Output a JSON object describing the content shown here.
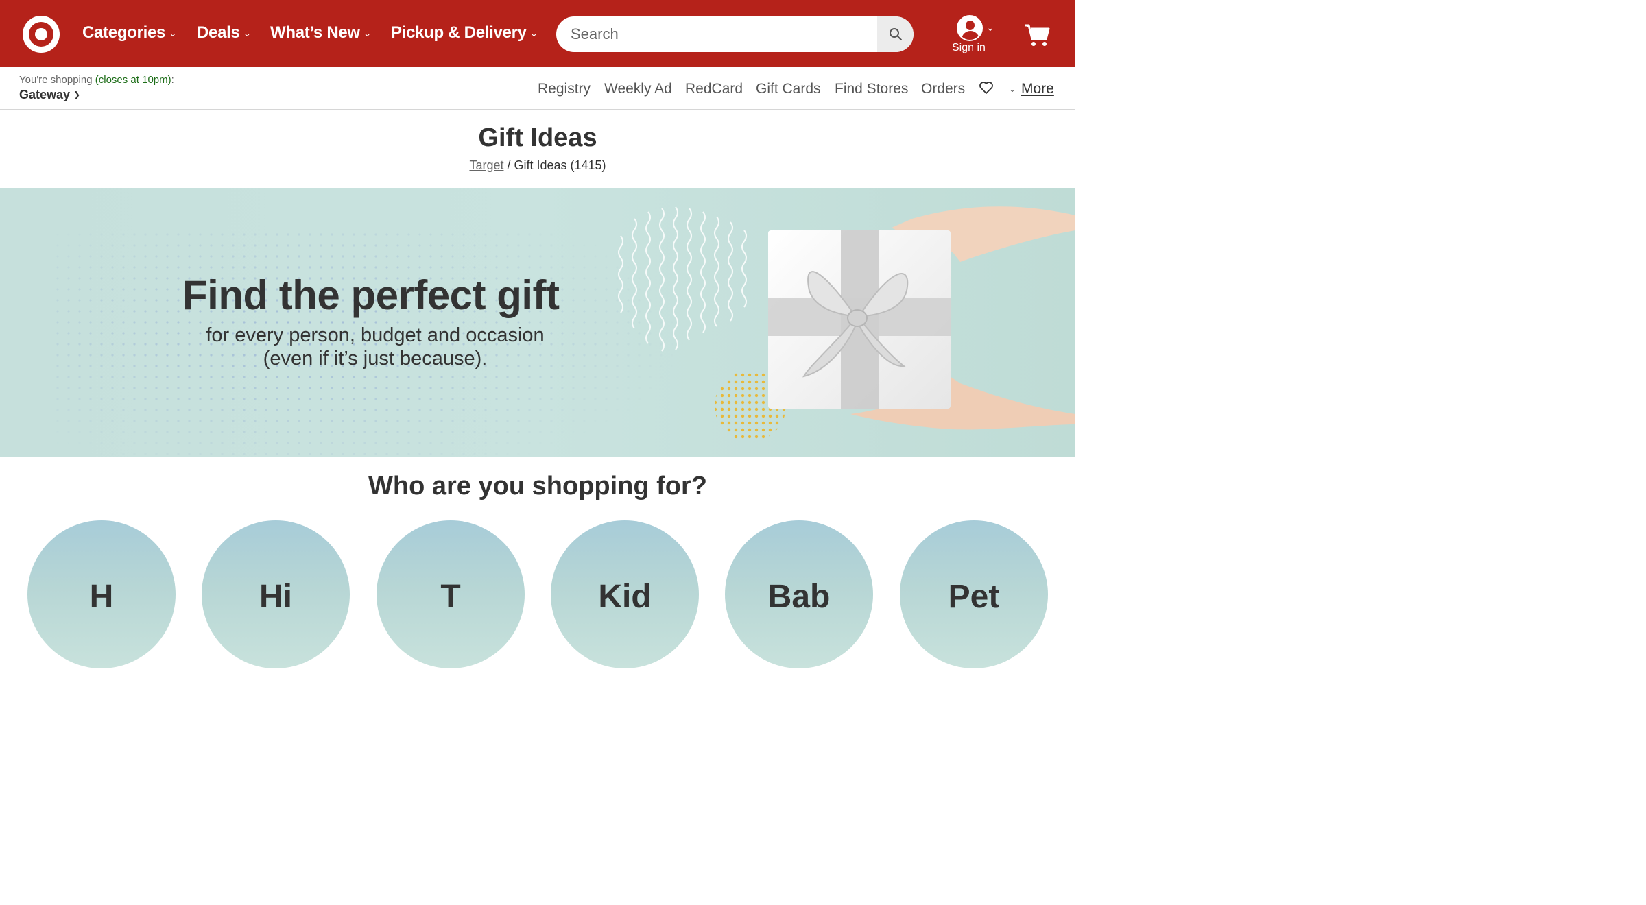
{
  "header": {
    "nav": [
      {
        "label": "Categories"
      },
      {
        "label": "Deals"
      },
      {
        "label": "What’s New"
      },
      {
        "label": "Pickup & Delivery"
      }
    ],
    "search_placeholder": "Search",
    "account_label": "Sign in",
    "brand_color": "#b5221a"
  },
  "subbar": {
    "shopping_prefix": "You're shopping",
    "closes": "(closes at 10pm)",
    "colon": ":",
    "store": "Gateway",
    "links": [
      "Registry",
      "Weekly Ad",
      "RedCard",
      "Gift Cards",
      "Find Stores",
      "Orders"
    ],
    "more": "More"
  },
  "page": {
    "title": "Gift Ideas",
    "breadcrumb_link": "Target",
    "breadcrumb_sep": " / ",
    "breadcrumb_current": "Gift Ideas (1415)"
  },
  "hero": {
    "headline": "Find the perfect gift",
    "sub_line1": "for every person, budget and occasion",
    "sub_line2": "(even if it’s just because)."
  },
  "section": {
    "title": "Who are you shopping for?",
    "circles": [
      "H",
      "Hi",
      "T",
      "Kid",
      "Bab",
      "Pet"
    ]
  }
}
